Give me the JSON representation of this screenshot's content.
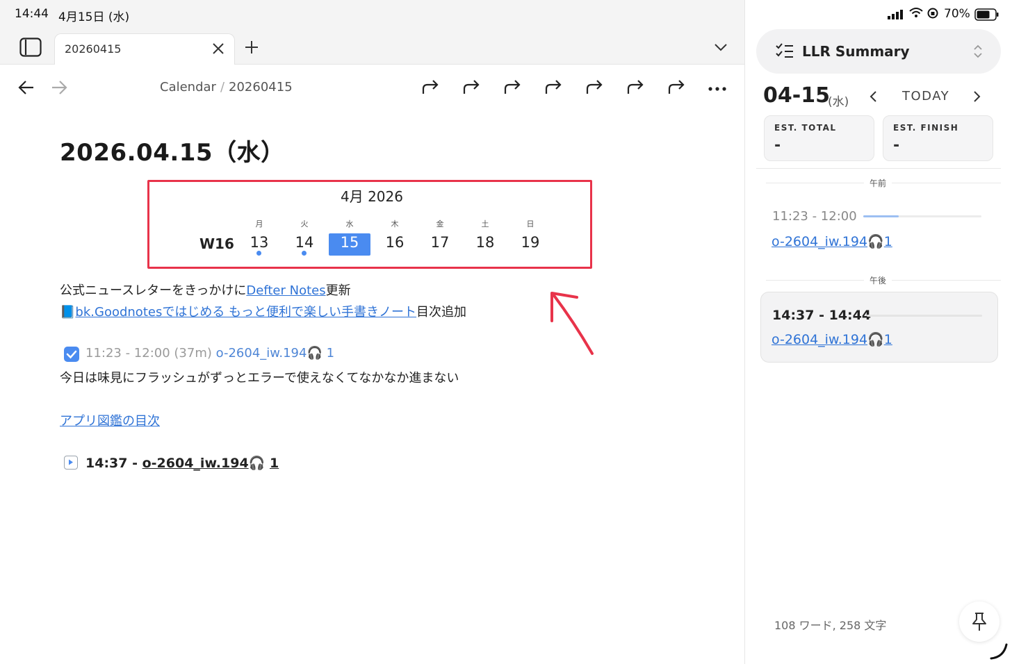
{
  "status": {
    "time": "14:44",
    "date": "4月15日 (水)",
    "battery": "70%"
  },
  "tab": {
    "label": "20260415"
  },
  "breadcrumb": {
    "parent": "Calendar",
    "separator": "/",
    "current": "20260415"
  },
  "page": {
    "title": "2026.04.15（水）"
  },
  "calendar": {
    "month_label": "4月  2026",
    "week_label": "W16",
    "days": [
      {
        "dow": "月",
        "num": "13",
        "dot": true,
        "selected": false
      },
      {
        "dow": "火",
        "num": "14",
        "dot": true,
        "selected": false
      },
      {
        "dow": "水",
        "num": "15",
        "dot": false,
        "selected": true
      },
      {
        "dow": "木",
        "num": "16",
        "dot": false,
        "selected": false
      },
      {
        "dow": "金",
        "num": "17",
        "dot": false,
        "selected": false
      },
      {
        "dow": "土",
        "num": "18",
        "dot": false,
        "selected": false
      },
      {
        "dow": "日",
        "num": "19",
        "dot": false,
        "selected": false
      }
    ]
  },
  "content": {
    "line1_prefix": "公式ニュースレターをきっかけに",
    "line1_link": "Defter Notes",
    "line1_suffix": "更新",
    "line2_emoji": "📘",
    "line2_link": "bk.Goodnotesではじめる もっと便利で楽しい手書きノート",
    "line2_suffix": "目次追加",
    "task_time": "11:23 - 12:00 (37m)",
    "task_link": "o-2604_iw.194",
    "task_count": "1",
    "task_note": "今日は味見にフラッシュがずっとエラーで使えなくてなかなか進まない",
    "index_link": "アプリ図鑑の目次",
    "running_time": "14:37 - ",
    "running_link": "o-2604_iw.194",
    "running_count": "1"
  },
  "sidebar": {
    "title": "LLR Summary",
    "date": "04-15",
    "dow": "(水)",
    "today_label": "TODAY",
    "est_total_label": "EST. TOTAL",
    "est_total_value": "-",
    "est_finish_label": "EST. FINISH",
    "est_finish_value": "-",
    "am_label": "午前",
    "pm_label": "午後",
    "am_entry": {
      "time": "11:23 - 12:00",
      "link": "o-2604_iw.194",
      "count": "1",
      "progress": 0.3
    },
    "pm_entry": {
      "time": "14:37 - 14:44",
      "link": "o-2604_iw.194",
      "count": "1"
    },
    "word_count": "108 ワード, 258 文字"
  }
}
